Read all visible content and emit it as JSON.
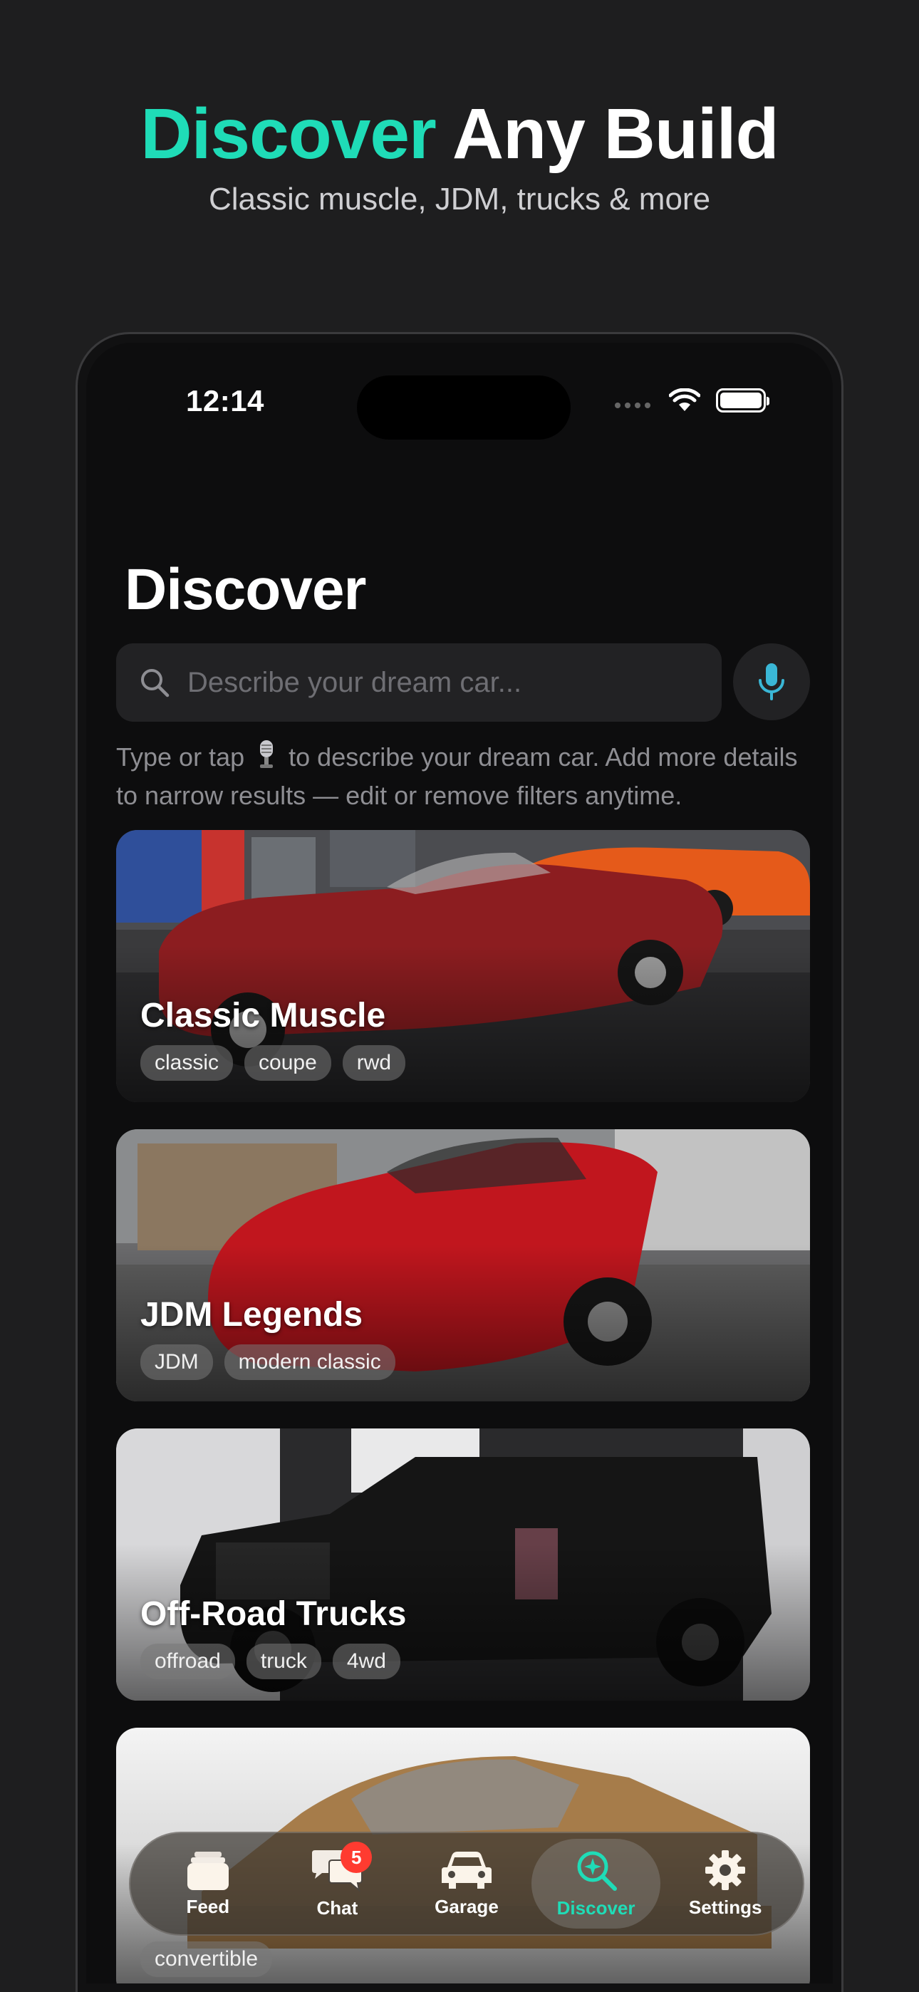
{
  "promo": {
    "title_accent": "Discover",
    "title_rest": " Any Build",
    "subtitle": "Classic muscle, JDM, trucks & more"
  },
  "status_bar": {
    "time": "12:14"
  },
  "discover": {
    "title": "Discover",
    "search": {
      "placeholder": "Describe your dream car...",
      "value": ""
    },
    "hint_before": "Type or tap",
    "hint_after": "to describe your dream car. Add more details to narrow results — edit or remove filters anytime.",
    "cards": [
      {
        "title": "Classic Muscle",
        "tags": [
          "classic",
          "coupe",
          "rwd"
        ]
      },
      {
        "title": "JDM Legends",
        "tags": [
          "JDM",
          "modern classic"
        ]
      },
      {
        "title": "Off-Road Trucks",
        "tags": [
          "offroad",
          "truck",
          "4wd"
        ]
      },
      {
        "title": "",
        "tags": [
          "convertible"
        ]
      }
    ]
  },
  "tabbar": {
    "tabs": [
      {
        "label": "Feed",
        "icon": "feed-icon"
      },
      {
        "label": "Chat",
        "icon": "chat-icon",
        "badge": "5"
      },
      {
        "label": "Garage",
        "icon": "car-icon"
      },
      {
        "label": "Discover",
        "icon": "discover-icon",
        "active": true
      },
      {
        "label": "Settings",
        "icon": "gear-icon"
      }
    ]
  },
  "colors": {
    "accent": "#1fdcb7",
    "mic_blue": "#3ab7d6",
    "badge": "#ff3b30",
    "background": "#1e1e1f"
  }
}
